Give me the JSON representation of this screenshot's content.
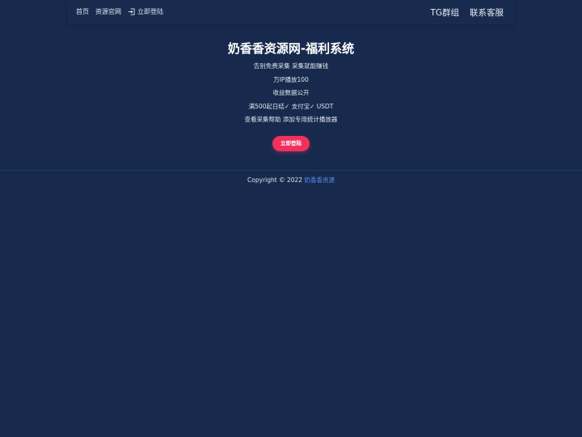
{
  "nav": {
    "left": {
      "home": "首页",
      "official_site": "资源官网",
      "login": "立即登陆"
    },
    "right": {
      "tg_group": "TG群组",
      "customer_service": "联系客服"
    }
  },
  "hero": {
    "title": "奶香香资源网-福利系统",
    "lines": [
      "告别免费采集 采集就能赚钱",
      "万IP播放100",
      "收益数据公开",
      "满500起日结✓ 支付宝✓ USDT",
      "查看采集帮助 添加专用统计播放器"
    ],
    "cta_label": "立即登陆"
  },
  "footer": {
    "copyright": "Copyright © 2022",
    "site_link": "奶香香资源"
  },
  "colors": {
    "background": "#172a4d",
    "accent": "#f0315e",
    "link": "#5b8def"
  }
}
